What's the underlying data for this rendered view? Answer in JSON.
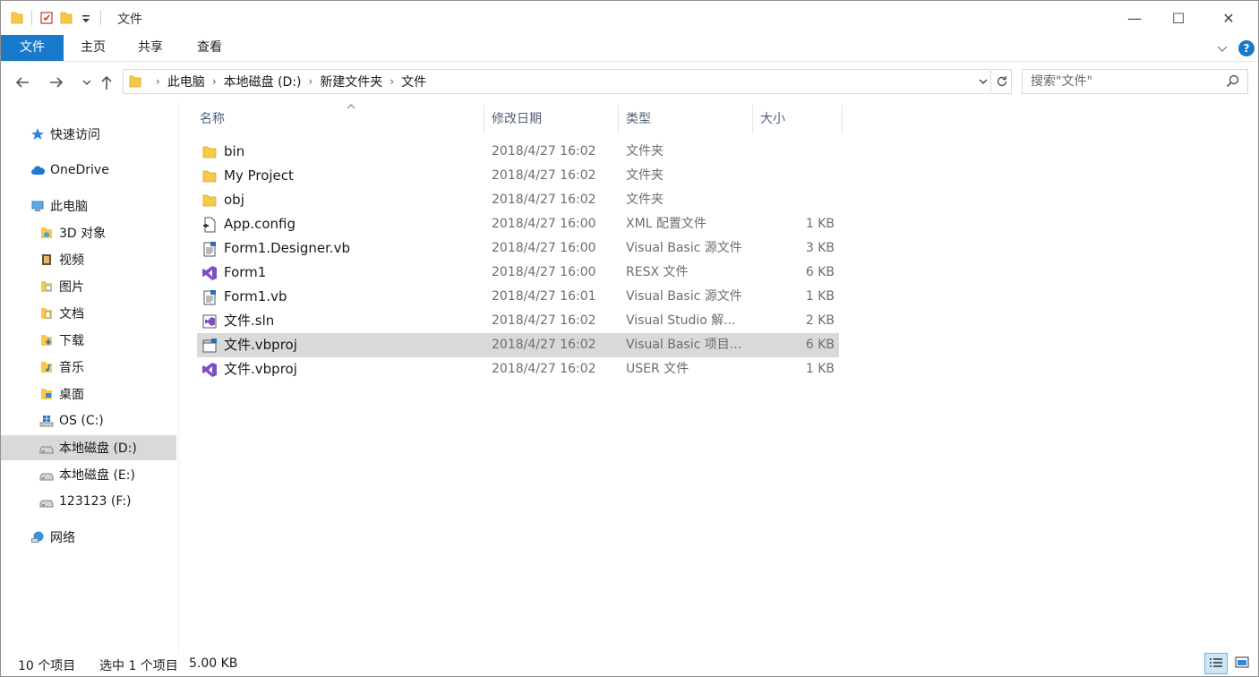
{
  "window": {
    "title": "文件",
    "controls": {
      "minimize": "—",
      "maximize": "☐",
      "close": "✕"
    }
  },
  "ribbon": {
    "tabs": [
      "文件",
      "主页",
      "共享",
      "查看"
    ],
    "help": "?",
    "accent": "#1979ca"
  },
  "navigation": {
    "back_icon": "arrow-left-icon",
    "forward_icon": "arrow-right-icon",
    "up_icon": "arrow-up-icon",
    "breadcrumbs": [
      "此电脑",
      "本地磁盘 (D:)",
      "新建文件夹",
      "文件"
    ],
    "search_placeholder": "搜索\"文件\""
  },
  "sidebar": {
    "items": [
      {
        "label": "快速访问",
        "icon": "star-icon"
      },
      {
        "label": "OneDrive",
        "icon": "cloud-icon"
      },
      {
        "label": "此电脑",
        "icon": "computer-icon"
      },
      {
        "label": "3D 对象",
        "icon": "3d-objects-icon"
      },
      {
        "label": "视频",
        "icon": "video-icon"
      },
      {
        "label": "图片",
        "icon": "pictures-icon"
      },
      {
        "label": "文档",
        "icon": "documents-icon"
      },
      {
        "label": "下载",
        "icon": "downloads-icon"
      },
      {
        "label": "音乐",
        "icon": "music-icon"
      },
      {
        "label": "桌面",
        "icon": "desktop-icon"
      },
      {
        "label": "OS (C:)",
        "icon": "windows-drive-icon"
      },
      {
        "label": "本地磁盘 (D:)",
        "icon": "drive-icon",
        "selected": true
      },
      {
        "label": "本地磁盘 (E:)",
        "icon": "drive-icon"
      },
      {
        "label": "123123 (F:)",
        "icon": "drive-icon"
      },
      {
        "label": "网络",
        "icon": "network-icon"
      }
    ]
  },
  "file_list": {
    "columns": [
      "名称",
      "修改日期",
      "类型",
      "大小"
    ],
    "rows": [
      {
        "name": "bin",
        "date": "2018/4/27 16:02",
        "type": "文件夹",
        "size": "",
        "icon": "folder-icon"
      },
      {
        "name": "My Project",
        "date": "2018/4/27 16:02",
        "type": "文件夹",
        "size": "",
        "icon": "folder-icon"
      },
      {
        "name": "obj",
        "date": "2018/4/27 16:02",
        "type": "文件夹",
        "size": "",
        "icon": "folder-icon"
      },
      {
        "name": "App.config",
        "date": "2018/4/27 16:00",
        "type": "XML 配置文件",
        "size": "1 KB",
        "icon": "config-file-icon"
      },
      {
        "name": "Form1.Designer.vb",
        "date": "2018/4/27 16:00",
        "type": "Visual Basic 源文件",
        "size": "3 KB",
        "icon": "vb-source-icon"
      },
      {
        "name": "Form1",
        "date": "2018/4/27 16:00",
        "type": "RESX 文件",
        "size": "6 KB",
        "icon": "visual-studio-icon"
      },
      {
        "name": "Form1.vb",
        "date": "2018/4/27 16:01",
        "type": "Visual Basic 源文件",
        "size": "1 KB",
        "icon": "vb-source-icon"
      },
      {
        "name": "文件.sln",
        "date": "2018/4/27 16:02",
        "type": "Visual Studio 解...",
        "size": "2 KB",
        "icon": "solution-file-icon"
      },
      {
        "name": "文件.vbproj",
        "date": "2018/4/27 16:02",
        "type": "Visual Basic 项目...",
        "size": "6 KB",
        "icon": "vb-project-icon",
        "selected": true
      },
      {
        "name": "文件.vbproj",
        "date": "2018/4/27 16:02",
        "type": "USER 文件",
        "size": "1 KB",
        "icon": "visual-studio-icon"
      }
    ]
  },
  "status_bar": {
    "item_count": "10 个项目",
    "selection": "选中 1 个项目",
    "selection_size": "5.00 KB"
  },
  "colors": {
    "selection": "#d9d9d9",
    "folder": "#f7c948",
    "vs_purple": "#7b4fc0",
    "header_text": "#4c607a"
  }
}
